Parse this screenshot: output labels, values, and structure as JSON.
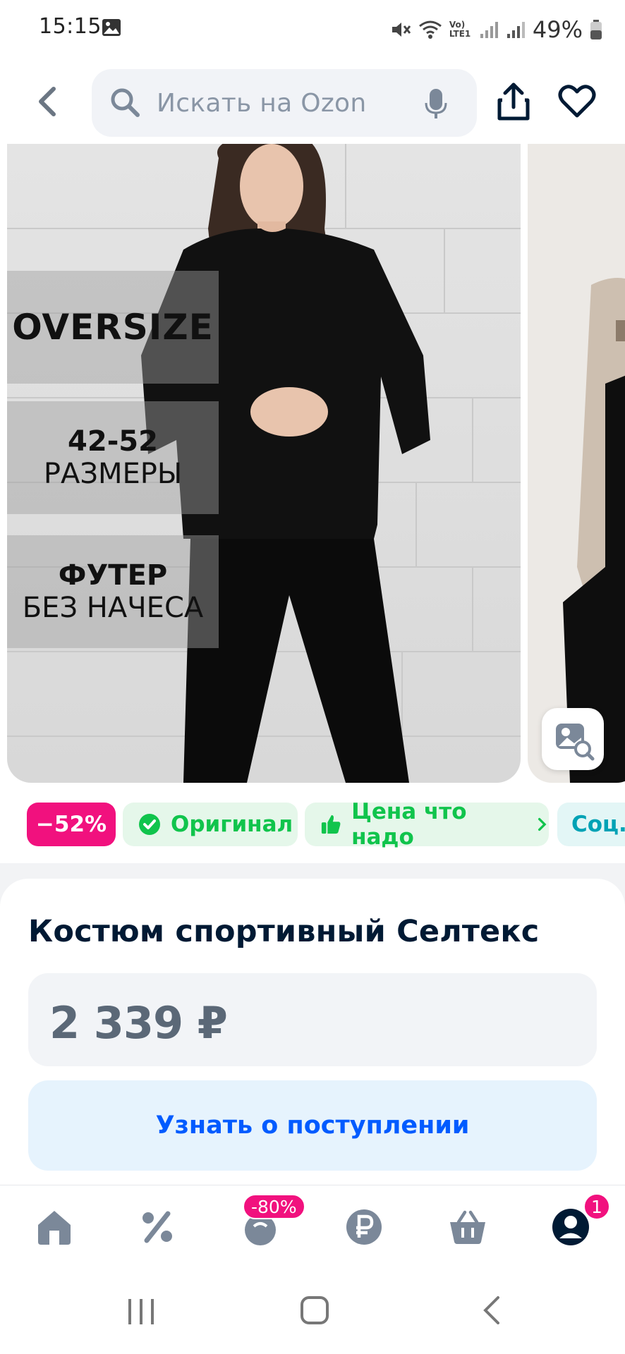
{
  "status_bar": {
    "time": "15:15",
    "battery": "49%",
    "network_label": "Vo) LTE1",
    "icons": [
      "gallery-icon",
      "mute-icon",
      "wifi-icon",
      "signal-icon",
      "battery-icon"
    ]
  },
  "header": {
    "search_placeholder": "Искать на Ozon",
    "icons": [
      "back-icon",
      "search-icon",
      "mic-icon",
      "share-icon",
      "heart-icon"
    ]
  },
  "gallery": {
    "features": {
      "oversize": "OVERSIZE",
      "sizes_num": "42-52",
      "sizes_word": "РАЗМЕРЫ",
      "fabric": "ФУТЕР",
      "fabric_note": "БЕЗ НАЧЕСА"
    }
  },
  "badges": {
    "discount": "−52%",
    "original": "Оригинал",
    "price_tag": "Цена что надо",
    "social": "Соц."
  },
  "product": {
    "title": "Костюм спортивный Селтекс",
    "price": "2 339 ₽",
    "notify_button": "Узнать о поступлении"
  },
  "bottom_nav": {
    "items": [
      "home",
      "discounts",
      "fresh",
      "finance",
      "cart",
      "profile"
    ],
    "promo_badge": "-80%",
    "profile_badge": "1"
  },
  "colors": {
    "accent_pink": "#f1117e",
    "accent_blue": "#005bff",
    "green": "#10c44c"
  }
}
